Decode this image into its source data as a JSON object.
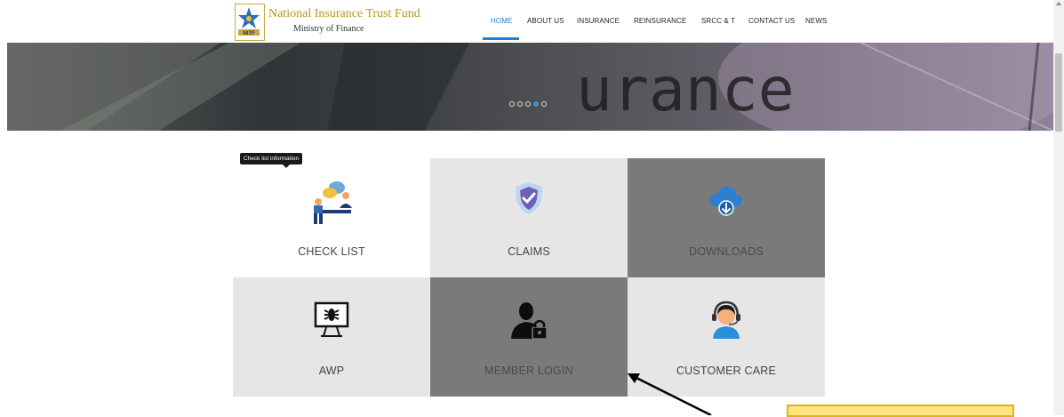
{
  "brand": {
    "title": "National Insurance Trust Fund",
    "subtitle": "Ministry of Finance",
    "logo_text": "NITF"
  },
  "nav": {
    "items": [
      {
        "label": "HOME",
        "active": true
      },
      {
        "label": "ABOUT US",
        "active": false
      },
      {
        "label": "INSURANCE",
        "active": false
      },
      {
        "label": "REINSURANCE",
        "active": false
      },
      {
        "label": "SRCC & T",
        "active": false
      },
      {
        "label": "CONTACT US",
        "active": false
      },
      {
        "label": "NEWS",
        "active": false
      }
    ]
  },
  "banner": {
    "text": "urance",
    "slide_count": 5,
    "active_slide": 4
  },
  "tooltip": {
    "text": "Check list information"
  },
  "tiles": [
    {
      "label": "CHECK LIST",
      "icon": "people-chat-icon",
      "bg": "#ffffff"
    },
    {
      "label": "CLAIMS",
      "icon": "shield-check-icon",
      "bg": "#e6e6e6"
    },
    {
      "label": "DOWNLOADS",
      "icon": "cloud-download-icon",
      "bg": "#7a7a7a"
    },
    {
      "label": "AWP",
      "icon": "monitor-bug-icon",
      "bg": "#e6e6e6"
    },
    {
      "label": "MEMBER LOGIN",
      "icon": "user-lock-icon",
      "bg": "#7a7a7a"
    },
    {
      "label": "CUSTOMER CARE",
      "icon": "headset-agent-icon",
      "bg": "#e6e6e6"
    }
  ],
  "colors": {
    "accent": "#1f7fd0",
    "brand_gold": "#b8941f",
    "tile_light": "#e6e6e6",
    "tile_dark": "#7a7a7a",
    "highlight": "#ffe680"
  }
}
